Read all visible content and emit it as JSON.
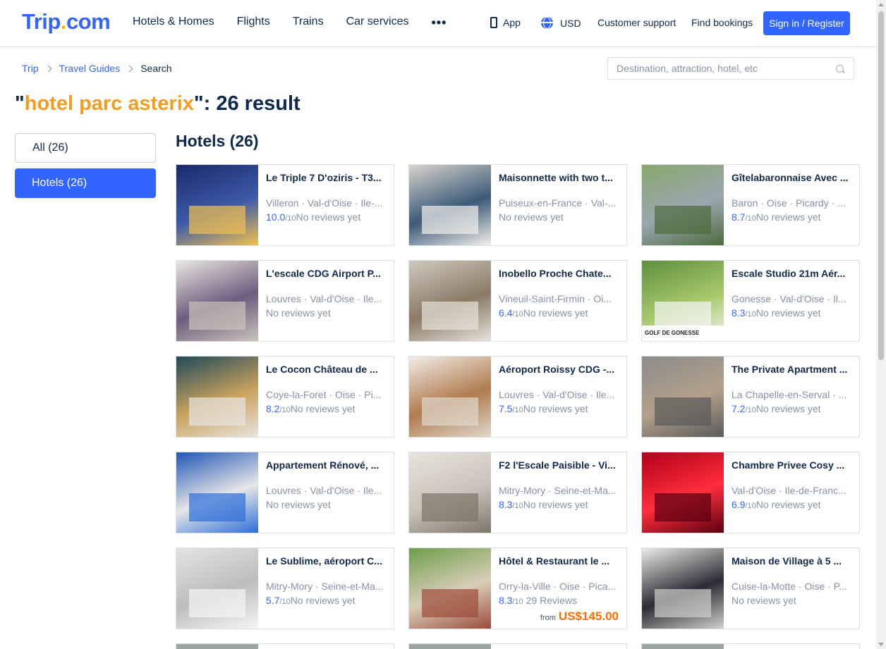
{
  "header": {
    "logo_main": "Trip",
    "logo_dot": ".",
    "logo_tld": "com",
    "nav": [
      "Hotels & Homes",
      "Flights",
      "Trains",
      "Car services",
      "•••"
    ],
    "app_label": "App",
    "currency": "USD",
    "support": "Customer support",
    "bookings": "Find bookings",
    "signin": "Sign in / Register"
  },
  "breadcrumb": {
    "items": [
      "Trip",
      "Travel Guides"
    ],
    "current": "Search"
  },
  "search": {
    "placeholder": "Destination, attraction, hotel, etc"
  },
  "results": {
    "quote_open": "\"",
    "keyword": "hotel parc asterix",
    "suffix": "\": 26 result"
  },
  "filters": {
    "all": "All (26)",
    "hotels": "Hotels (26)"
  },
  "section_title": "Hotels (26)",
  "colors": {
    "brand_blue": "#3264ff",
    "keyword_orange": "#f29d1e",
    "price_orange": "#ff6f00"
  },
  "hotels": [
    {
      "name": "Le Triple 7 D'oziris - T3...",
      "location": "Villeron · Val-d'Oise · Ile-...",
      "score": "10.0",
      "of": "/10",
      "reviews": "No reviews yet"
    },
    {
      "name": "Maisonnette with two t...",
      "location": "Puiseux-en-France · Val-...",
      "score": "",
      "of": "",
      "reviews": "No reviews yet"
    },
    {
      "name": "Gîtelabaronnaise Avec ...",
      "location": "Baron · Oise · Picardy · ...",
      "score": "8.7",
      "of": "/10",
      "reviews": "No reviews yet"
    },
    {
      "name": "L'escale CDG Airport P...",
      "location": "Louvres · Val-d'Oise · Ile...",
      "score": "",
      "of": "",
      "reviews": "No reviews yet"
    },
    {
      "name": "Inobello Proche Chate...",
      "location": "Vineuil-Saint-Firmin · Oi...",
      "score": "6.4",
      "of": "/10",
      "reviews": "No reviews yet"
    },
    {
      "name": "Escale Studio 21m Aér...",
      "location": "Gonesse · Val-d'Oise · Il...",
      "score": "8.3",
      "of": "/10",
      "reviews": "No reviews yet",
      "img_caption": "GOLF DE GONESSE"
    },
    {
      "name": "Le Cocon Château de ...",
      "location": "Coye-la-Foret · Oise · Pi...",
      "score": "8.2",
      "of": "/10",
      "reviews": "No reviews yet"
    },
    {
      "name": "Aéroport Roissy CDG -...",
      "location": "Louvres · Val-d'Oise · Ile...",
      "score": "7.5",
      "of": "/10",
      "reviews": "No reviews yet"
    },
    {
      "name": "The Private Apartment ...",
      "location": "La Chapelle-en-Serval · ...",
      "score": "7.2",
      "of": "/10",
      "reviews": "No reviews yet"
    },
    {
      "name": "Appartement Rénové, ...",
      "location": "Louvres · Val-d'Oise · Ile...",
      "score": "",
      "of": "",
      "reviews": "No reviews yet"
    },
    {
      "name": "F2 l'Escale Paisible - Vi...",
      "location": "Mitry-Mory · Seine-et-Ma...",
      "score": "8.3",
      "of": "/10",
      "reviews": "No reviews yet"
    },
    {
      "name": "Chambre Privee Cosy ...",
      "location": "Val-d'Oise · Ile-de-Franc...",
      "score": "6.9",
      "of": "/10",
      "reviews": "No reviews yet"
    },
    {
      "name": "Le Sublime, aéroport C...",
      "location": "Mitry-Mory · Seine-et-Ma...",
      "score": "5.7",
      "of": "/10",
      "reviews": "No reviews yet"
    },
    {
      "name": "Hôtel & Restaurant le ...",
      "location": "Orry-la-Ville · Oise · Pica...",
      "score": "8.3",
      "of": "/10",
      "reviews": "  29 Reviews",
      "price_from": "from",
      "price": "US$145.00"
    },
    {
      "name": "Maison de Village à 5 ...",
      "location": "Cuise-la-Motte · Oise · P...",
      "score": "",
      "of": "",
      "reviews": "No reviews yet"
    }
  ]
}
